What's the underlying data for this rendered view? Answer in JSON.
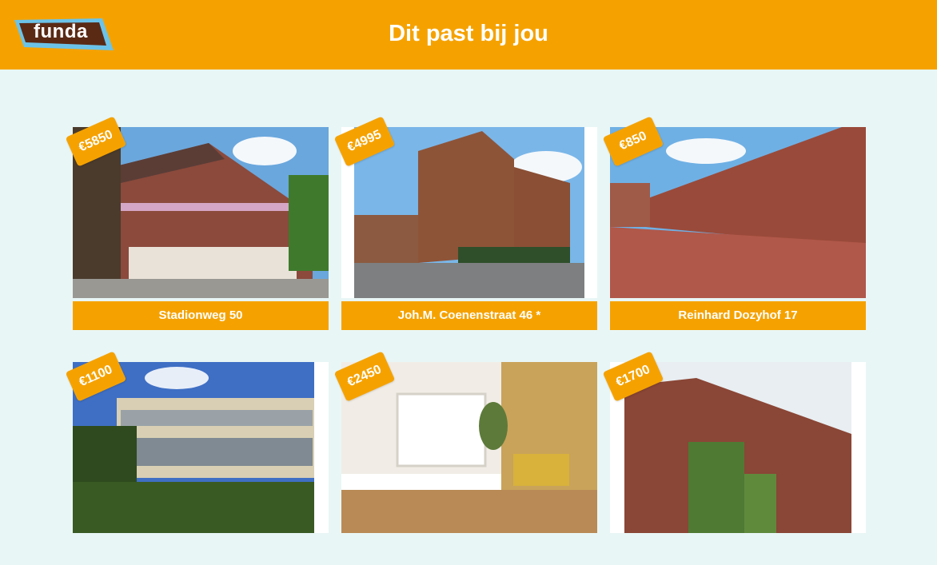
{
  "header": {
    "logo_text": "funda",
    "title": "Dit past bij jou"
  },
  "listings": [
    {
      "price": "€5850",
      "address": "Stadionweg 50"
    },
    {
      "price": "€4995",
      "address": "Joh.M. Coenenstraat 46 *"
    },
    {
      "price": "€850",
      "address": "Reinhard Dozyhof 17"
    },
    {
      "price": "€1100",
      "address": ""
    },
    {
      "price": "€2450",
      "address": ""
    },
    {
      "price": "€1700",
      "address": ""
    }
  ],
  "colors": {
    "accent": "#f5a200",
    "background": "#e9f6f6",
    "logo_brown": "#5a2a14",
    "logo_blue": "#6cc3e8"
  }
}
